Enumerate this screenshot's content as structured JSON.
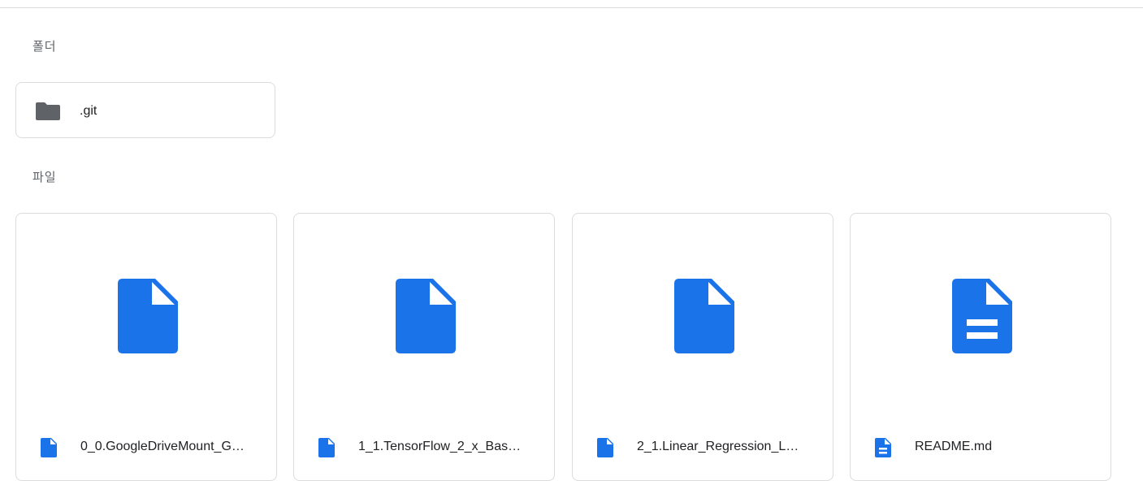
{
  "sections": {
    "folders_label": "폴더",
    "files_label": "파일"
  },
  "folders": [
    {
      "name": ".git",
      "icon": "folder-icon"
    }
  ],
  "files": [
    {
      "name": "0_0.GoogleDriveMount_G…",
      "icon": "file-icon"
    },
    {
      "name": "1_1.TensorFlow_2_x_Bas…",
      "icon": "file-icon"
    },
    {
      "name": "2_1.Linear_Regression_L…",
      "icon": "file-icon"
    },
    {
      "name": "README.md",
      "icon": "document-icon"
    }
  ],
  "colors": {
    "accent_blue": "#1a73e8",
    "folder_gray": "#5f6368",
    "border": "#dadce0"
  }
}
